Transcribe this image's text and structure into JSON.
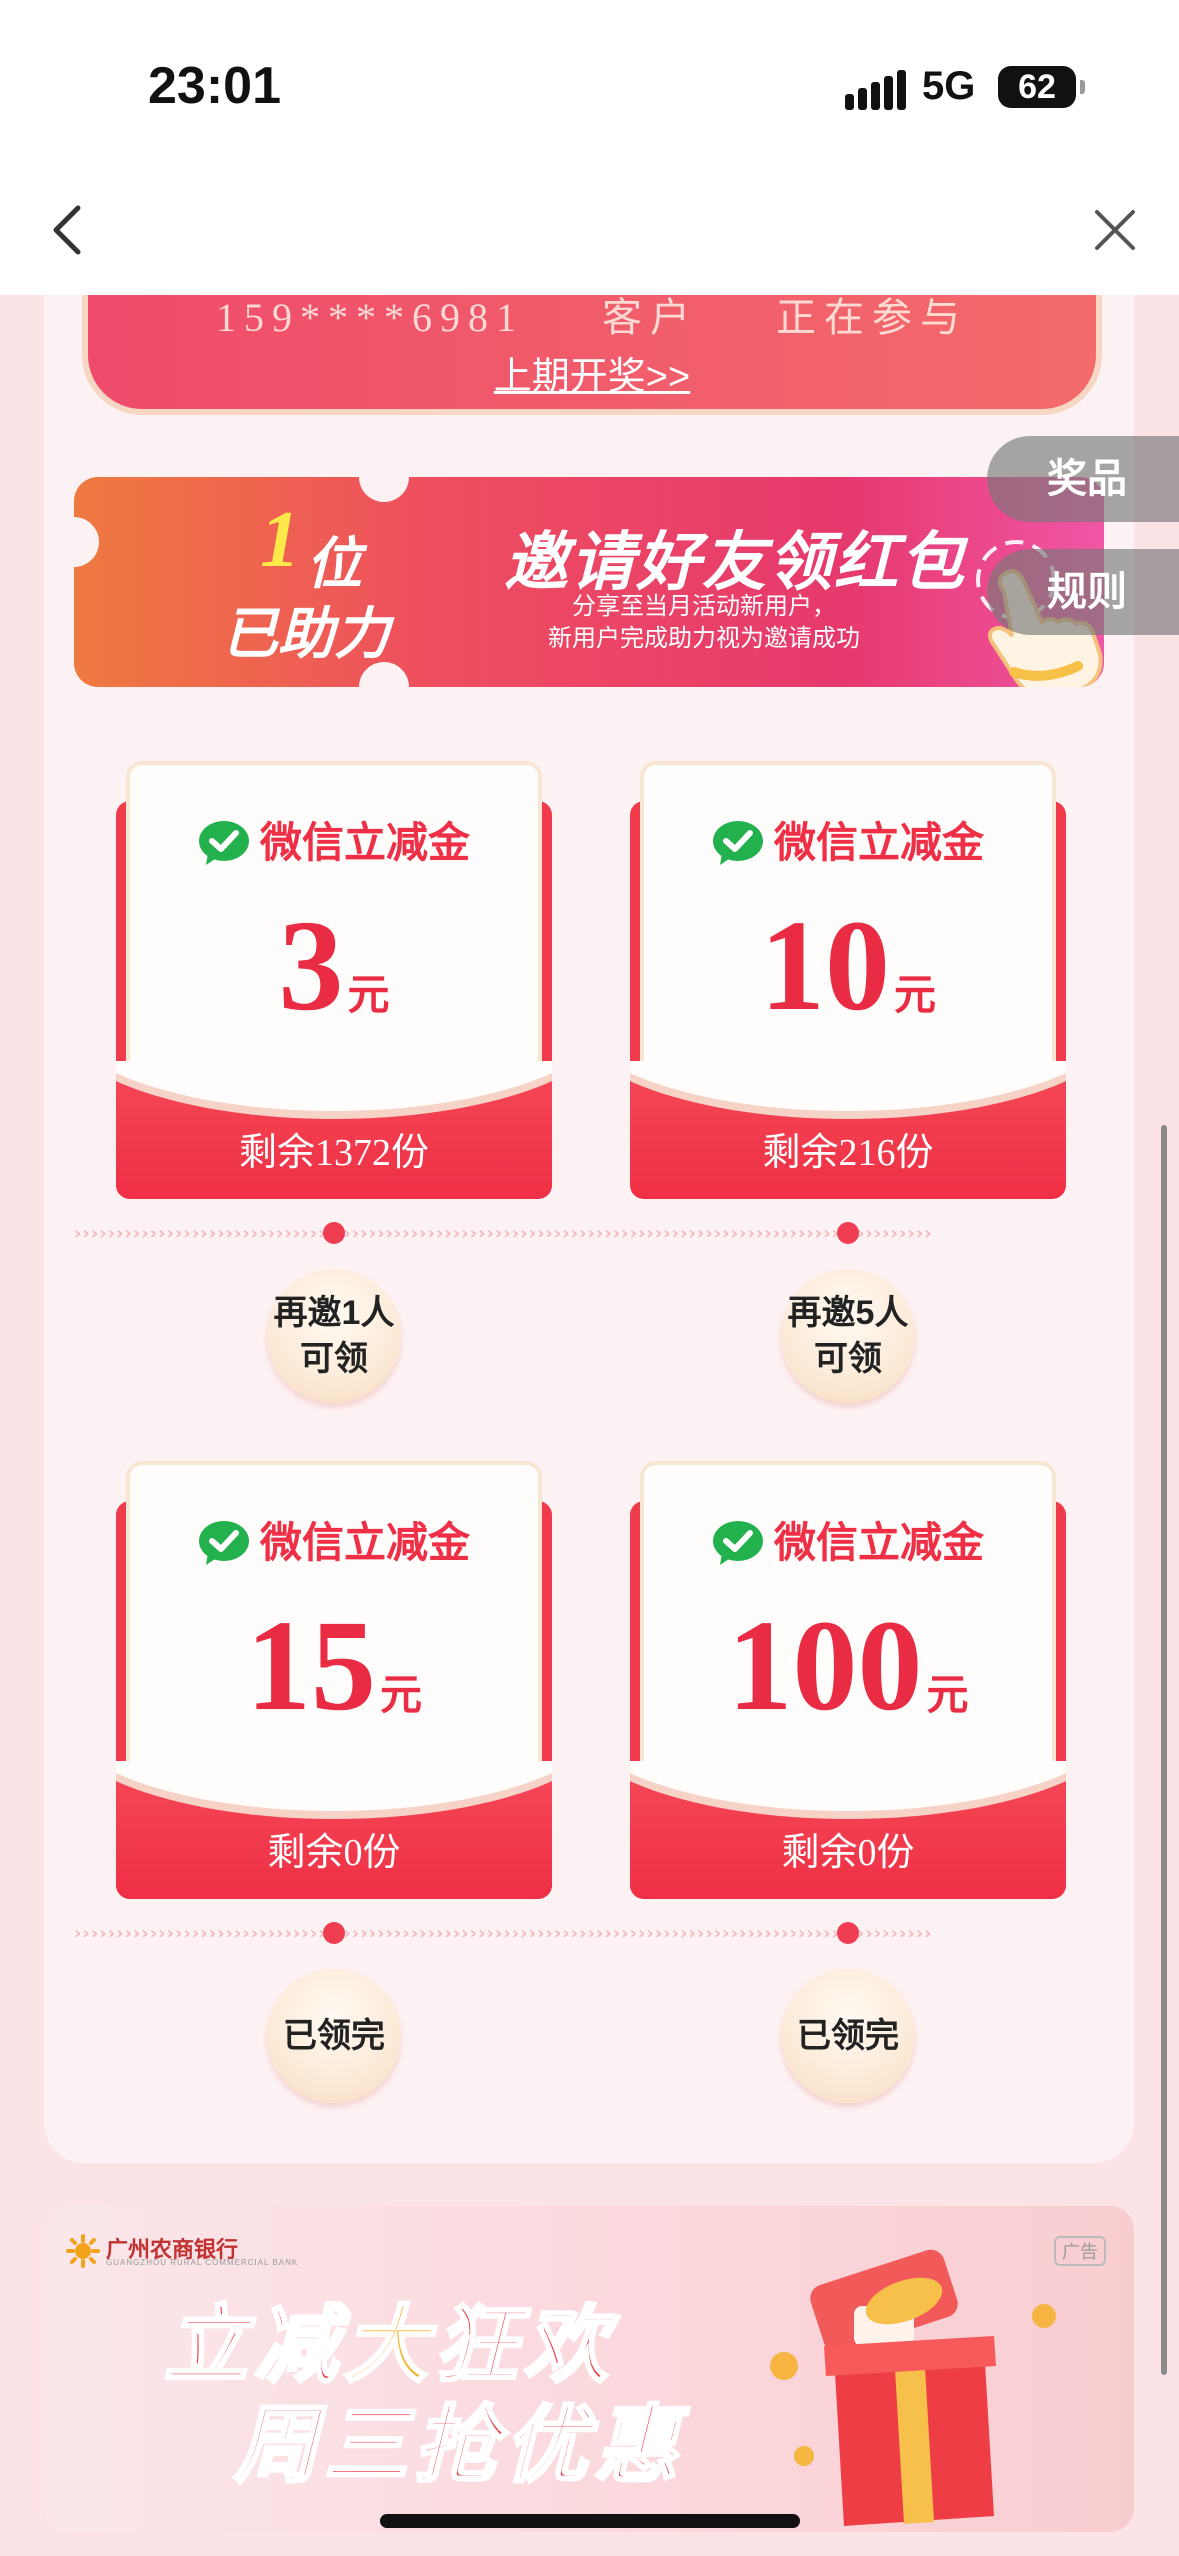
{
  "status_bar": {
    "time": "23:01",
    "network": "5G",
    "battery": "62"
  },
  "lottery": {
    "ticker": "159****6981 客户 正在参与",
    "link": "上期开奖>>"
  },
  "invite": {
    "count": "1",
    "count_unit": "位",
    "count_label": "已助力",
    "title": "邀请好友领红包",
    "subtitle_line1": "分享至当月活动新用户，",
    "subtitle_line2": "新用户完成助力视为邀请成功"
  },
  "side_tabs": {
    "prizes": "奖品",
    "rules": "规则"
  },
  "vouchers": [
    {
      "title": "微信立减金",
      "amount": "3",
      "unit": "元",
      "remaining": "剩余1372份",
      "action": "再邀1人\n可领"
    },
    {
      "title": "微信立减金",
      "amount": "10",
      "unit": "元",
      "remaining": "剩余216份",
      "action": "再邀5人\n可领"
    },
    {
      "title": "微信立减金",
      "amount": "15",
      "unit": "元",
      "remaining": "剩余0份",
      "action": "已领完"
    },
    {
      "title": "微信立减金",
      "amount": "100",
      "unit": "元",
      "remaining": "剩余0份",
      "action": "已领完"
    }
  ],
  "ad": {
    "bank_name": "广州农商银行",
    "bank_name_en": "GUANGZHOU RURAL COMMERCIAL BANK",
    "tag": "广告",
    "headline_part1": "立减",
    "headline_highlight": "大",
    "headline_part2": "狂欢",
    "headline_line2": "周三抢优惠"
  },
  "colors": {
    "accent": "#ee2f45",
    "brand_wechat": "#22b14c",
    "page_bg": "#fbe3e6"
  }
}
